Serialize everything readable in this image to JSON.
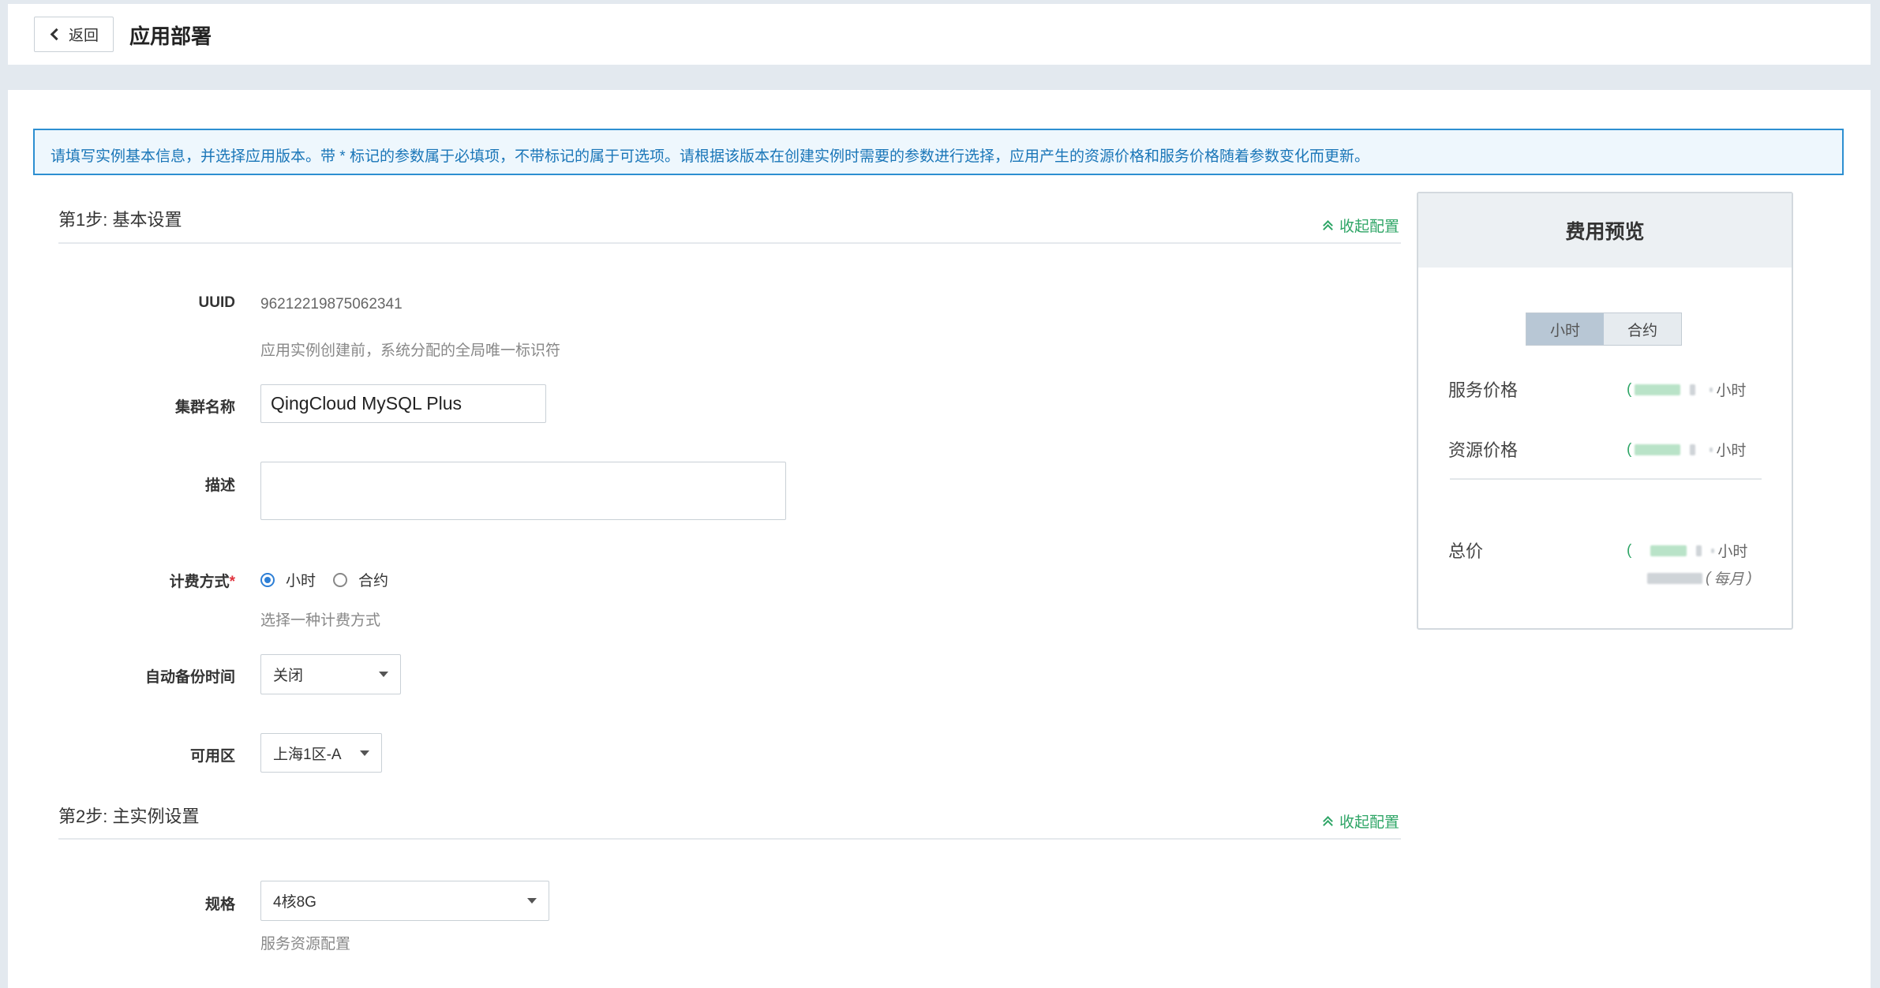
{
  "header": {
    "back_label": "返回",
    "title": "应用部署"
  },
  "notice": "请填写实例基本信息，并选择应用版本。带 * 标记的参数属于必填项，不带标记的属于可选项。请根据该版本在创建实例时需要的参数进行选择，应用产生的资源价格和服务价格随着参数变化而更新。",
  "step1": {
    "title": "第1步: 基本设置",
    "collapse_label": "收起配置",
    "uuid_label": "UUID",
    "uuid_value": "96212219875062341",
    "uuid_hint": "应用实例创建前，系统分配的全局唯一标识符",
    "cluster_name_label": "集群名称",
    "cluster_name_value": "QingCloud MySQL Plus",
    "description_label": "描述",
    "description_value": "",
    "billing_label": "计费方式",
    "billing_required_mark": "*",
    "billing_options": [
      "小时",
      "合约"
    ],
    "billing_selected": "小时",
    "billing_hint": "选择一种计费方式",
    "backup_label": "自动备份时间",
    "backup_value": "关闭",
    "zone_label": "可用区",
    "zone_value": "上海1区-A"
  },
  "step2": {
    "title": "第2步: 主实例设置",
    "collapse_label": "收起配置",
    "spec_label": "规格",
    "spec_value": "4核8G",
    "spec_hint": "服务资源配置"
  },
  "fee_preview": {
    "title": "费用预览",
    "toggle_options": [
      "小时",
      "合约"
    ],
    "toggle_active": "小时",
    "service_price_label": "服务价格",
    "service_price_unit": "小时",
    "resource_price_label": "资源价格",
    "resource_price_unit": "小时",
    "total_label": "总价",
    "total_unit": "小时",
    "monthly_suffix": "每月"
  },
  "colors": {
    "accent_green": "#2ea566",
    "notice_blue": "#1a76b8",
    "required_red": "#e0323d"
  }
}
